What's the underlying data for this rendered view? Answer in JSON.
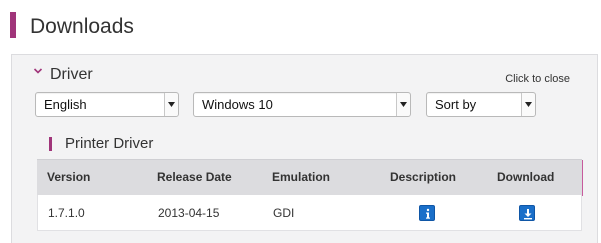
{
  "header": {
    "title": "Downloads"
  },
  "panel": {
    "section_title": "Driver",
    "close_label": "Click to close",
    "filters": {
      "language": "English",
      "os": "Windows 10",
      "sort": "Sort by"
    },
    "subsection_title": "Printer Driver",
    "table": {
      "headers": [
        "Version",
        "Release Date",
        "Emulation",
        "Description",
        "Download"
      ],
      "rows": [
        {
          "version": "1.7.1.0",
          "release_date": "2013-04-15",
          "emulation": "GDI",
          "description_icon": "info-icon",
          "download_icon": "download-icon"
        }
      ]
    }
  },
  "colors": {
    "accent": "#a0357a",
    "icon_blue": "#1a6fc9",
    "panel_bg": "#f3f3f4",
    "header_row": "#dcdcdf"
  }
}
